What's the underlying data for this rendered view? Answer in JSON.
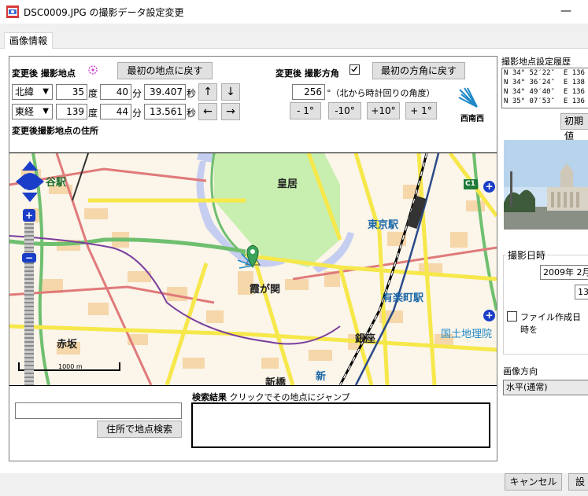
{
  "window": {
    "title": "DSC0009.JPG の撮影データ設定変更",
    "minimize_glyph": "—"
  },
  "tab": {
    "label": "画像情報"
  },
  "location": {
    "heading": "変更後 撮影地点",
    "reset_label": "最初の地点に戻す",
    "lat": {
      "hemisphere": "北緯",
      "deg": "35",
      "min": "40",
      "sec": "39.407"
    },
    "lon": {
      "hemisphere": "東経",
      "deg": "139",
      "min": "44",
      "sec": "13.561"
    },
    "unit_deg": "度",
    "unit_min": "分",
    "unit_sec": "秒",
    "arrows": {
      "up": "↑",
      "down": "↓",
      "left": "←",
      "right": "→"
    },
    "address_heading": "変更後撮影地点の住所"
  },
  "direction": {
    "heading": "変更後 撮影方角",
    "checked": true,
    "reset_label": "最初の方角に戻す",
    "angle": "256",
    "angle_note": "°（北から時計回りの角度）",
    "buttons": [
      "- 1°",
      "-10°",
      "+10°",
      "+ 1°"
    ],
    "compass_label": "西南西"
  },
  "map": {
    "labels": {
      "yotsuya": "谷駅",
      "kokyo": "皇居",
      "tokyo_station": "東京駅",
      "kasumigaseki": "霞が関",
      "yurakucho": "有楽町駅",
      "akasaka": "赤坂",
      "ginza": "銀座",
      "shinbashi": "新橋",
      "shin": "新",
      "gsi": "国土地理院",
      "c1": "C1",
      "scale": "1000 m"
    },
    "zoom_plus": "+",
    "zoom_minus": "−"
  },
  "search": {
    "input_value": "",
    "button_label": "住所で地点検索",
    "results_heading": "検索結果",
    "results_hint": "クリックでその地点にジャンプ"
  },
  "side": {
    "history_heading": "撮影地点設定履歴",
    "history": [
      "N 34° 52′22″  E 136",
      "N 34° 36′24″  E 138",
      "N 34° 49′40″  E 136",
      "N 35° 07′53″  E 136"
    ],
    "init_button": "初期値",
    "date_group": "撮影日時",
    "date_value": "2009年  2月",
    "time_value": "13:",
    "file_date_label": "ファイル作成日時を",
    "orientation_heading": "画像方向",
    "orientation_value": "水平(通常)"
  },
  "footer": {
    "cancel": "キャンセル",
    "ok": "設"
  },
  "colors": {
    "water": "#c5cef0",
    "park": "#c8efaf",
    "yellow_road": "#f6e84a",
    "green_road": "#6fbf6f",
    "red_road": "#e07a7a",
    "building": "#f5d2a0"
  }
}
